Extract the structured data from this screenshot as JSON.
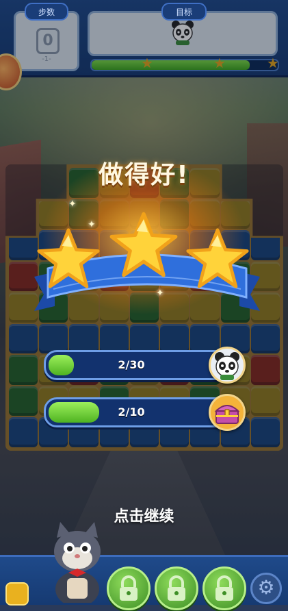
{
  "hud": {
    "moves_label": "步数",
    "moves_value": "0",
    "moves_sub": "-1-",
    "goal_label": "目标",
    "goal_icon": "panda-icon",
    "progress": 0.85
  },
  "result": {
    "title": "做得好!",
    "stars_earned": 3,
    "stars_total": 3
  },
  "goals": [
    {
      "text": "2/30",
      "current": 2,
      "target": 30,
      "icon": "panda-icon"
    },
    {
      "text": "2/10",
      "current": 2,
      "target": 10,
      "icon": "treasure-chest-icon"
    }
  ],
  "continue_text": "点击继续",
  "colors": {
    "accent_blue": "#1f4a8a",
    "ribbon_blue": "#2f6fdc",
    "star_yellow": "#ffd33a",
    "progress_green": "#5fc52c"
  }
}
